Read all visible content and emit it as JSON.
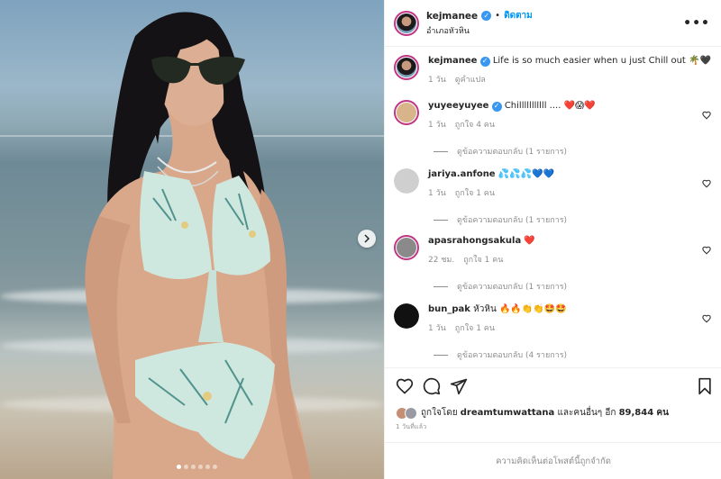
{
  "post": {
    "username": "kejmanee",
    "follow_label": "ติดตาม",
    "location": "อำเภอหัวหิน",
    "more_icon": "more-horizontal-icon"
  },
  "caption": {
    "username": "kejmanee",
    "text": "Life is so much easier when u just Chill out 🌴🖤",
    "age": "1 วัน",
    "translate": "ดูคำแปล"
  },
  "comments": [
    {
      "username": "yuyeeyuyee",
      "verified": true,
      "text": "Chilllllllllll .... ❤️😱❤️",
      "age": "1 วัน",
      "likes": "ถูกใจ 4 คน",
      "replies": "ดูข้อความตอบกลับ (1 รายการ)",
      "avatar_color": "#d8b48a"
    },
    {
      "username": "jariya.anfone",
      "verified": false,
      "text": "💦💦💦💙💙",
      "age": "1 วัน",
      "likes": "ถูกใจ 1 คน",
      "replies": "ดูข้อความตอบกลับ (1 รายการ)",
      "avatar_color": "#cfcfcf"
    },
    {
      "username": "apasrahongsakula",
      "verified": false,
      "text": "❤️",
      "age": "22 ชม.",
      "likes": "ถูกใจ 1 คน",
      "replies": "ดูข้อความตอบกลับ (1 รายการ)",
      "avatar_color": "#8a8a8a"
    },
    {
      "username": "bun_pak",
      "verified": false,
      "text": "หัวหิน 🔥🔥👏👏🤩🤩",
      "age": "1 วัน",
      "likes": "ถูกใจ 1 คน",
      "replies": "ดูข้อความตอบกลับ (4 รายการ)",
      "avatar_color": "#111111"
    }
  ],
  "actions": {
    "like_icon": "heart-icon",
    "comment_icon": "comment-icon",
    "share_icon": "send-icon",
    "save_icon": "bookmark-icon"
  },
  "likes": {
    "prefix": "ถูกใจโดย",
    "liker": "dreamtumwattana",
    "middle": "และคนอื่นๆ อีก",
    "count": "89,844",
    "suffix": "คน"
  },
  "time_label": "1 วันที่แล้ว",
  "comments_closed": "ความคิดเห็นต่อโพสต์นี้ถูกจำกัด",
  "carousel": {
    "total": 6,
    "active": 0
  },
  "colors": {
    "accent": "#0095f6",
    "verified": "#3897f0",
    "text": "#262626",
    "muted": "#8e8e8e",
    "story_ring": "#c13584"
  }
}
